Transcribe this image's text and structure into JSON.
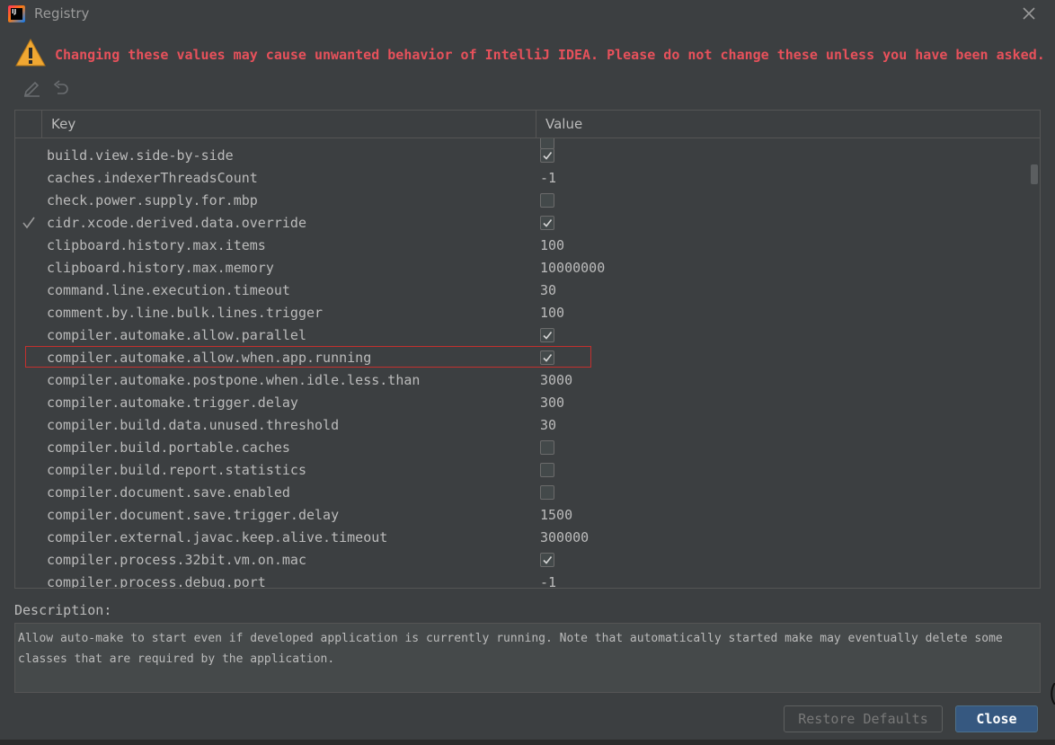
{
  "window": {
    "title": "Registry",
    "app_icon_text": "IJ"
  },
  "warning": {
    "text": "Changing these values may cause unwanted behavior of IntelliJ IDEA. Please do not change these unless you have been asked."
  },
  "table": {
    "columns": {
      "key": "Key",
      "value": "Value"
    },
    "rows": [
      {
        "key": "build.view.side-by-side",
        "type": "bool",
        "checked": true,
        "modified": false
      },
      {
        "key": "caches.indexerThreadsCount",
        "type": "text",
        "value": "-1",
        "modified": false
      },
      {
        "key": "check.power.supply.for.mbp",
        "type": "bool",
        "checked": false,
        "modified": false
      },
      {
        "key": "cidr.xcode.derived.data.override",
        "type": "bool",
        "checked": true,
        "modified": true
      },
      {
        "key": "clipboard.history.max.items",
        "type": "text",
        "value": "100",
        "modified": false
      },
      {
        "key": "clipboard.history.max.memory",
        "type": "text",
        "value": "10000000",
        "modified": false
      },
      {
        "key": "command.line.execution.timeout",
        "type": "text",
        "value": "30",
        "modified": false
      },
      {
        "key": "comment.by.line.bulk.lines.trigger",
        "type": "text",
        "value": "100",
        "modified": false
      },
      {
        "key": "compiler.automake.allow.parallel",
        "type": "bool",
        "checked": true,
        "modified": false
      },
      {
        "key": "compiler.automake.allow.when.app.running",
        "type": "bool",
        "checked": true,
        "modified": false,
        "selected": true
      },
      {
        "key": "compiler.automake.postpone.when.idle.less.than",
        "type": "text",
        "value": "3000",
        "modified": false
      },
      {
        "key": "compiler.automake.trigger.delay",
        "type": "text",
        "value": "300",
        "modified": false
      },
      {
        "key": "compiler.build.data.unused.threshold",
        "type": "text",
        "value": "30",
        "modified": false
      },
      {
        "key": "compiler.build.portable.caches",
        "type": "bool",
        "checked": false,
        "modified": false
      },
      {
        "key": "compiler.build.report.statistics",
        "type": "bool",
        "checked": false,
        "modified": false
      },
      {
        "key": "compiler.document.save.enabled",
        "type": "bool",
        "checked": false,
        "modified": false
      },
      {
        "key": "compiler.document.save.trigger.delay",
        "type": "text",
        "value": "1500",
        "modified": false
      },
      {
        "key": "compiler.external.javac.keep.alive.timeout",
        "type": "text",
        "value": "300000",
        "modified": false
      },
      {
        "key": "compiler.process.32bit.vm.on.mac",
        "type": "bool",
        "checked": true,
        "modified": false
      },
      {
        "key": "compiler.process.debug.port",
        "type": "text",
        "value": "-1",
        "modified": false
      }
    ]
  },
  "description": {
    "label": "Description:",
    "text": "Allow auto-make to start even if developed application is currently running. Note that automatically started make may eventually delete some classes that are required by the application."
  },
  "buttons": {
    "restore_defaults": "Restore Defaults",
    "close": "Close"
  },
  "colors": {
    "background": "#3c3f41",
    "warning_text": "#e7515b",
    "selection_border": "#c3302e",
    "primary_button": "#365880"
  },
  "icons": [
    "app-icon",
    "close-icon",
    "warning-icon",
    "edit-icon",
    "revert-icon",
    "check-icon"
  ]
}
